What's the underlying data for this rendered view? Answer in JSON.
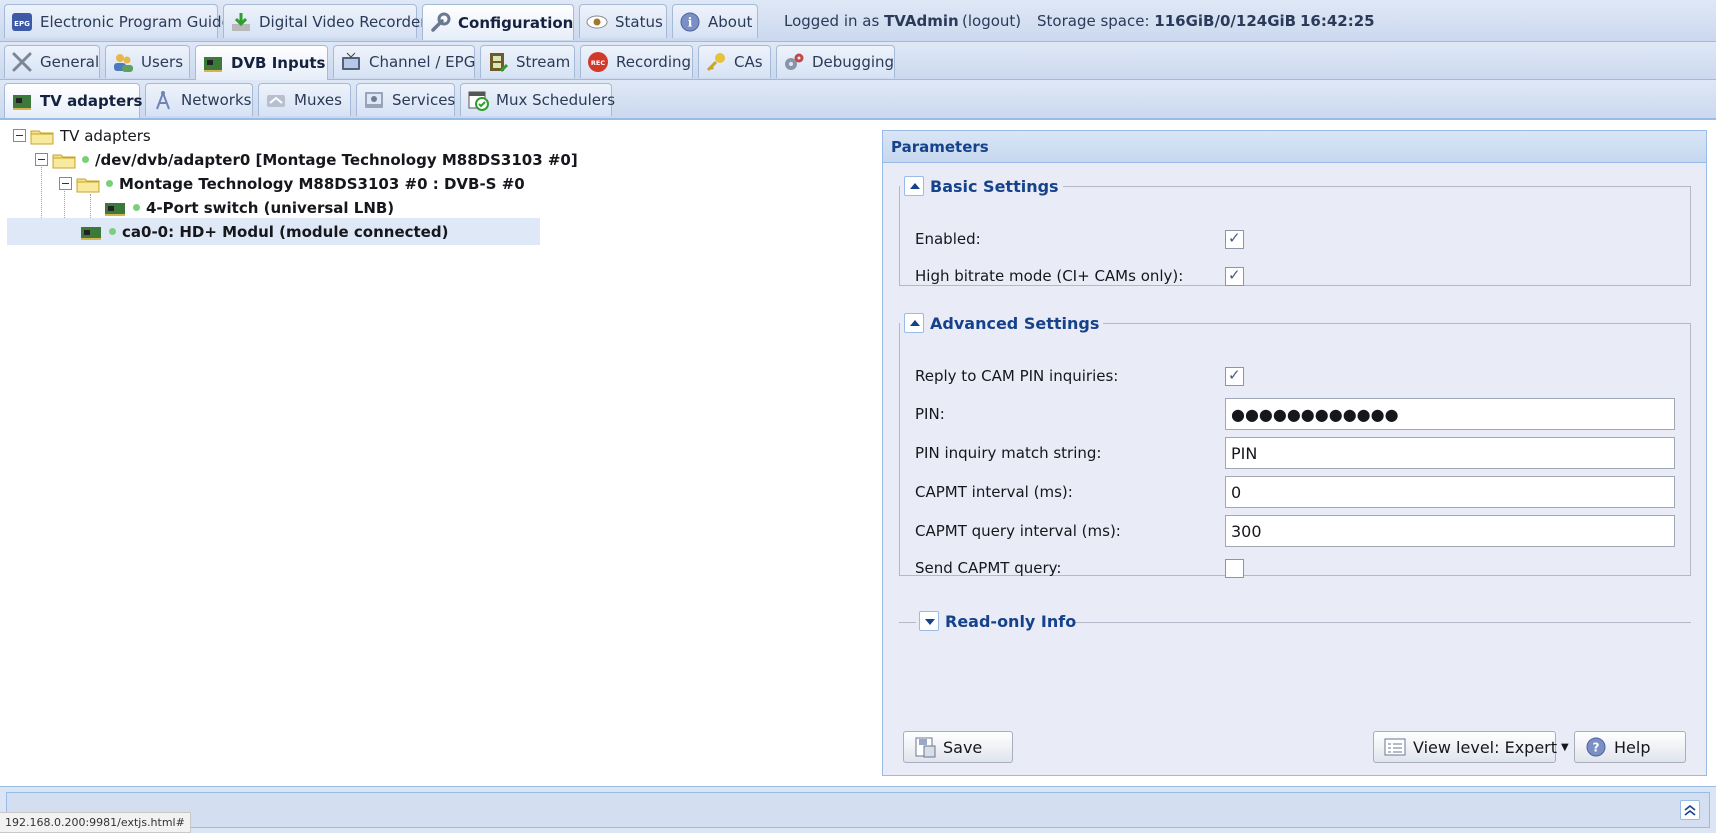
{
  "top_tabs": [
    {
      "label": "Electronic Program Guide",
      "icon": "epg-icon"
    },
    {
      "label": "Digital Video Recorder",
      "icon": "download-icon"
    },
    {
      "label": "Configuration",
      "icon": "wrench-icon"
    },
    {
      "label": "Status",
      "icon": "eye-icon"
    },
    {
      "label": "About",
      "icon": "info-icon"
    }
  ],
  "status": {
    "logged_prefix": "Logged in as",
    "user": "TVAdmin",
    "logout": "(logout)",
    "storage_prefix": "Storage space:",
    "storage": "116GiB/0/124GiB",
    "time": "16:42:25"
  },
  "config_tabs": [
    {
      "label": "General",
      "icon": "tools-icon"
    },
    {
      "label": "Users",
      "icon": "users-icon"
    },
    {
      "label": "DVB Inputs",
      "icon": "card-icon"
    },
    {
      "label": "Channel / EPG",
      "icon": "tv-icon"
    },
    {
      "label": "Stream",
      "icon": "film-icon"
    },
    {
      "label": "Recording",
      "icon": "rec-icon"
    },
    {
      "label": "CAs",
      "icon": "key-icon"
    },
    {
      "label": "Debugging",
      "icon": "gears-icon"
    }
  ],
  "dvb_tabs": [
    {
      "label": "TV adapters",
      "icon": "card-icon"
    },
    {
      "label": "Networks",
      "icon": "antenna-icon"
    },
    {
      "label": "Muxes",
      "icon": "mux-icon"
    },
    {
      "label": "Services",
      "icon": "services-icon"
    },
    {
      "label": "Mux Schedulers",
      "icon": "calendar-icon"
    }
  ],
  "tree": {
    "root": "TV adapters",
    "adapter": "/dev/dvb/adapter0 [Montage Technology M88DS3103 #0]",
    "frontend": "Montage Technology M88DS3103 #0 : DVB-S #0",
    "switch": "4-Port switch (universal LNB)",
    "ca": "ca0-0: HD+ Modul (module connected)"
  },
  "panel": {
    "title": "Parameters",
    "basic_title": "Basic Settings",
    "basic": [
      {
        "label": "Enabled:",
        "checked": true
      },
      {
        "label": "High bitrate mode (CI+ CAMs only):",
        "checked": true
      }
    ],
    "advanced_title": "Advanced Settings",
    "advanced": {
      "reply_label": "Reply to CAM PIN inquiries:",
      "pin_label": "PIN:",
      "pin_value": "●●●●●●●●●●●●",
      "match_label": "PIN inquiry match string:",
      "match_value": "PIN",
      "capmt_label": "CAPMT interval (ms):",
      "capmt_value": "0",
      "query_label": "CAPMT query interval (ms):",
      "query_value": "300",
      "send_label": "Send CAPMT query:"
    },
    "readonly_title": "Read-only Info",
    "save": "Save",
    "view_level": "View level: Expert",
    "help": "Help"
  },
  "statusbar_url": "192.168.0.200:9981/extjs.html#"
}
